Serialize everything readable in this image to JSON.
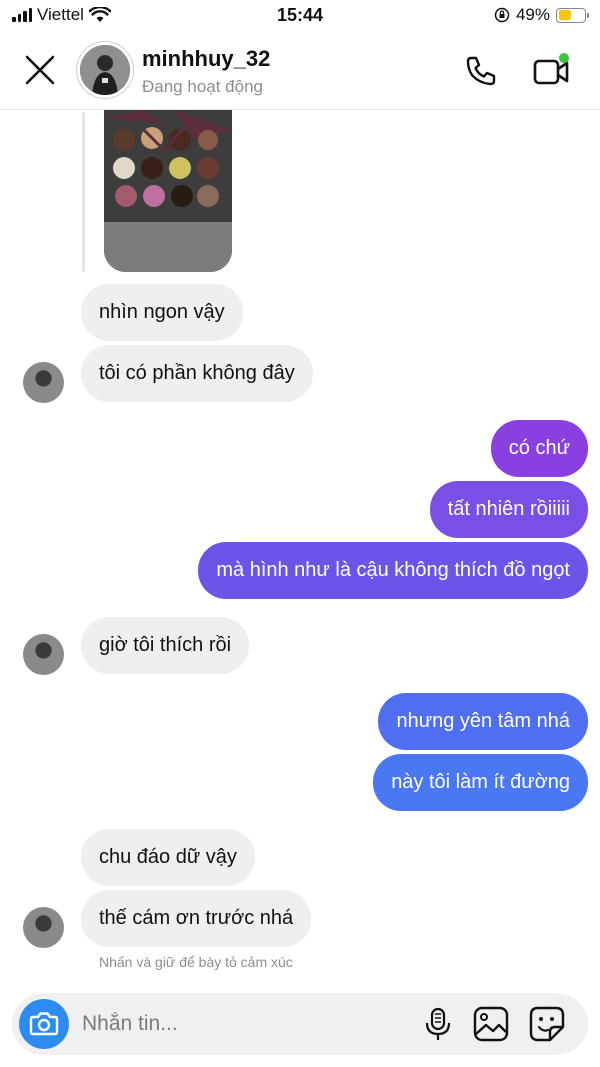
{
  "status_bar": {
    "carrier": "Viettel",
    "time": "15:44",
    "battery_percent": "49%",
    "battery_level": 0.49,
    "icons": [
      "signal-icon",
      "wifi-icon",
      "rotation-lock-icon",
      "battery-charging-icon"
    ]
  },
  "header": {
    "username": "minhhuy_32",
    "status": "Đang hoạt động",
    "icons": [
      "close-icon",
      "phone-icon",
      "video-call-icon"
    ],
    "online_dot_color": "#3ac43a"
  },
  "messages": [
    {
      "from": "them",
      "text": "nhìn ngon vậy"
    },
    {
      "from": "them",
      "text": "tôi có phần không đây"
    },
    {
      "from": "me",
      "text": "có chứ"
    },
    {
      "from": "me",
      "text": "tất nhiên rồiiiii"
    },
    {
      "from": "me",
      "text": "mà hình như là cậu không thích đồ ngọt"
    },
    {
      "from": "them",
      "text": "giờ tôi thích rồi"
    },
    {
      "from": "me",
      "text": "nhưng yên tâm nhá"
    },
    {
      "from": "me",
      "text": "này tôi làm ít đường"
    },
    {
      "from": "them",
      "text": "chu đáo dữ vậy"
    },
    {
      "from": "them",
      "text": "thế cám ơn trước nhá"
    }
  ],
  "reaction_hint": "Nhấn và giữ để bày tỏ cảm xúc",
  "composer": {
    "placeholder": "Nhắn tin...",
    "icons": [
      "camera-icon",
      "microphone-icon",
      "gallery-icon",
      "sticker-icon"
    ]
  },
  "colors": {
    "incoming_bubble": "#efefef",
    "outgoing_gradient": [
      "#8a3fe0",
      "#7a4fe6",
      "#6a55e8",
      "#5f62ea",
      "#4f6ff0",
      "#4a78f2"
    ],
    "camera_button": "#2d8cf0"
  }
}
